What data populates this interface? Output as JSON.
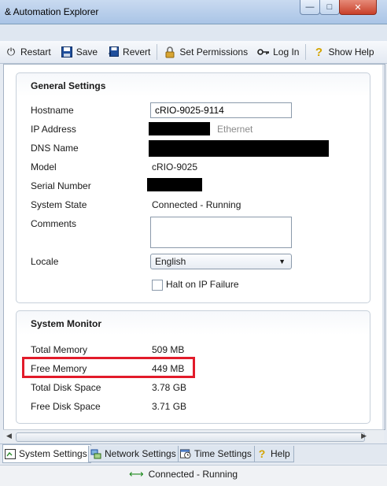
{
  "window": {
    "title": "& Automation Explorer"
  },
  "toolbar": {
    "restart": "Restart",
    "save": "Save",
    "revert": "Revert",
    "set_permissions": "Set Permissions",
    "log_in": "Log In",
    "show_help": "Show Help"
  },
  "general_settings": {
    "heading": "General Settings",
    "hostname_label": "Hostname",
    "hostname_value": "cRIO-9025-9114",
    "ip_label": "IP Address",
    "ip_suffix": "Ethernet",
    "dns_label": "DNS Name",
    "model_label": "Model",
    "model_value": "cRIO-9025",
    "serial_label": "Serial Number",
    "state_label": "System State",
    "state_value": "Connected - Running",
    "comments_label": "Comments",
    "comments_value": "",
    "locale_label": "Locale",
    "locale_value": "English",
    "halt_label": "Halt on IP Failure"
  },
  "system_monitor": {
    "heading": "System Monitor",
    "rows": [
      {
        "label": "Total Memory",
        "value": "509 MB"
      },
      {
        "label": "Free Memory",
        "value": "449 MB"
      },
      {
        "label": "Total Disk Space",
        "value": "3.78 GB"
      },
      {
        "label": "Free Disk Space",
        "value": "3.71 GB"
      }
    ]
  },
  "tabs": [
    {
      "label": "System Settings",
      "active": true
    },
    {
      "label": "Network Settings",
      "active": false
    },
    {
      "label": "Time Settings",
      "active": false
    },
    {
      "label": "Help",
      "active": false
    }
  ],
  "status": {
    "text": "Connected - Running"
  },
  "colors": {
    "highlight": "#e21b2a",
    "status_green": "#1e8a1e"
  }
}
